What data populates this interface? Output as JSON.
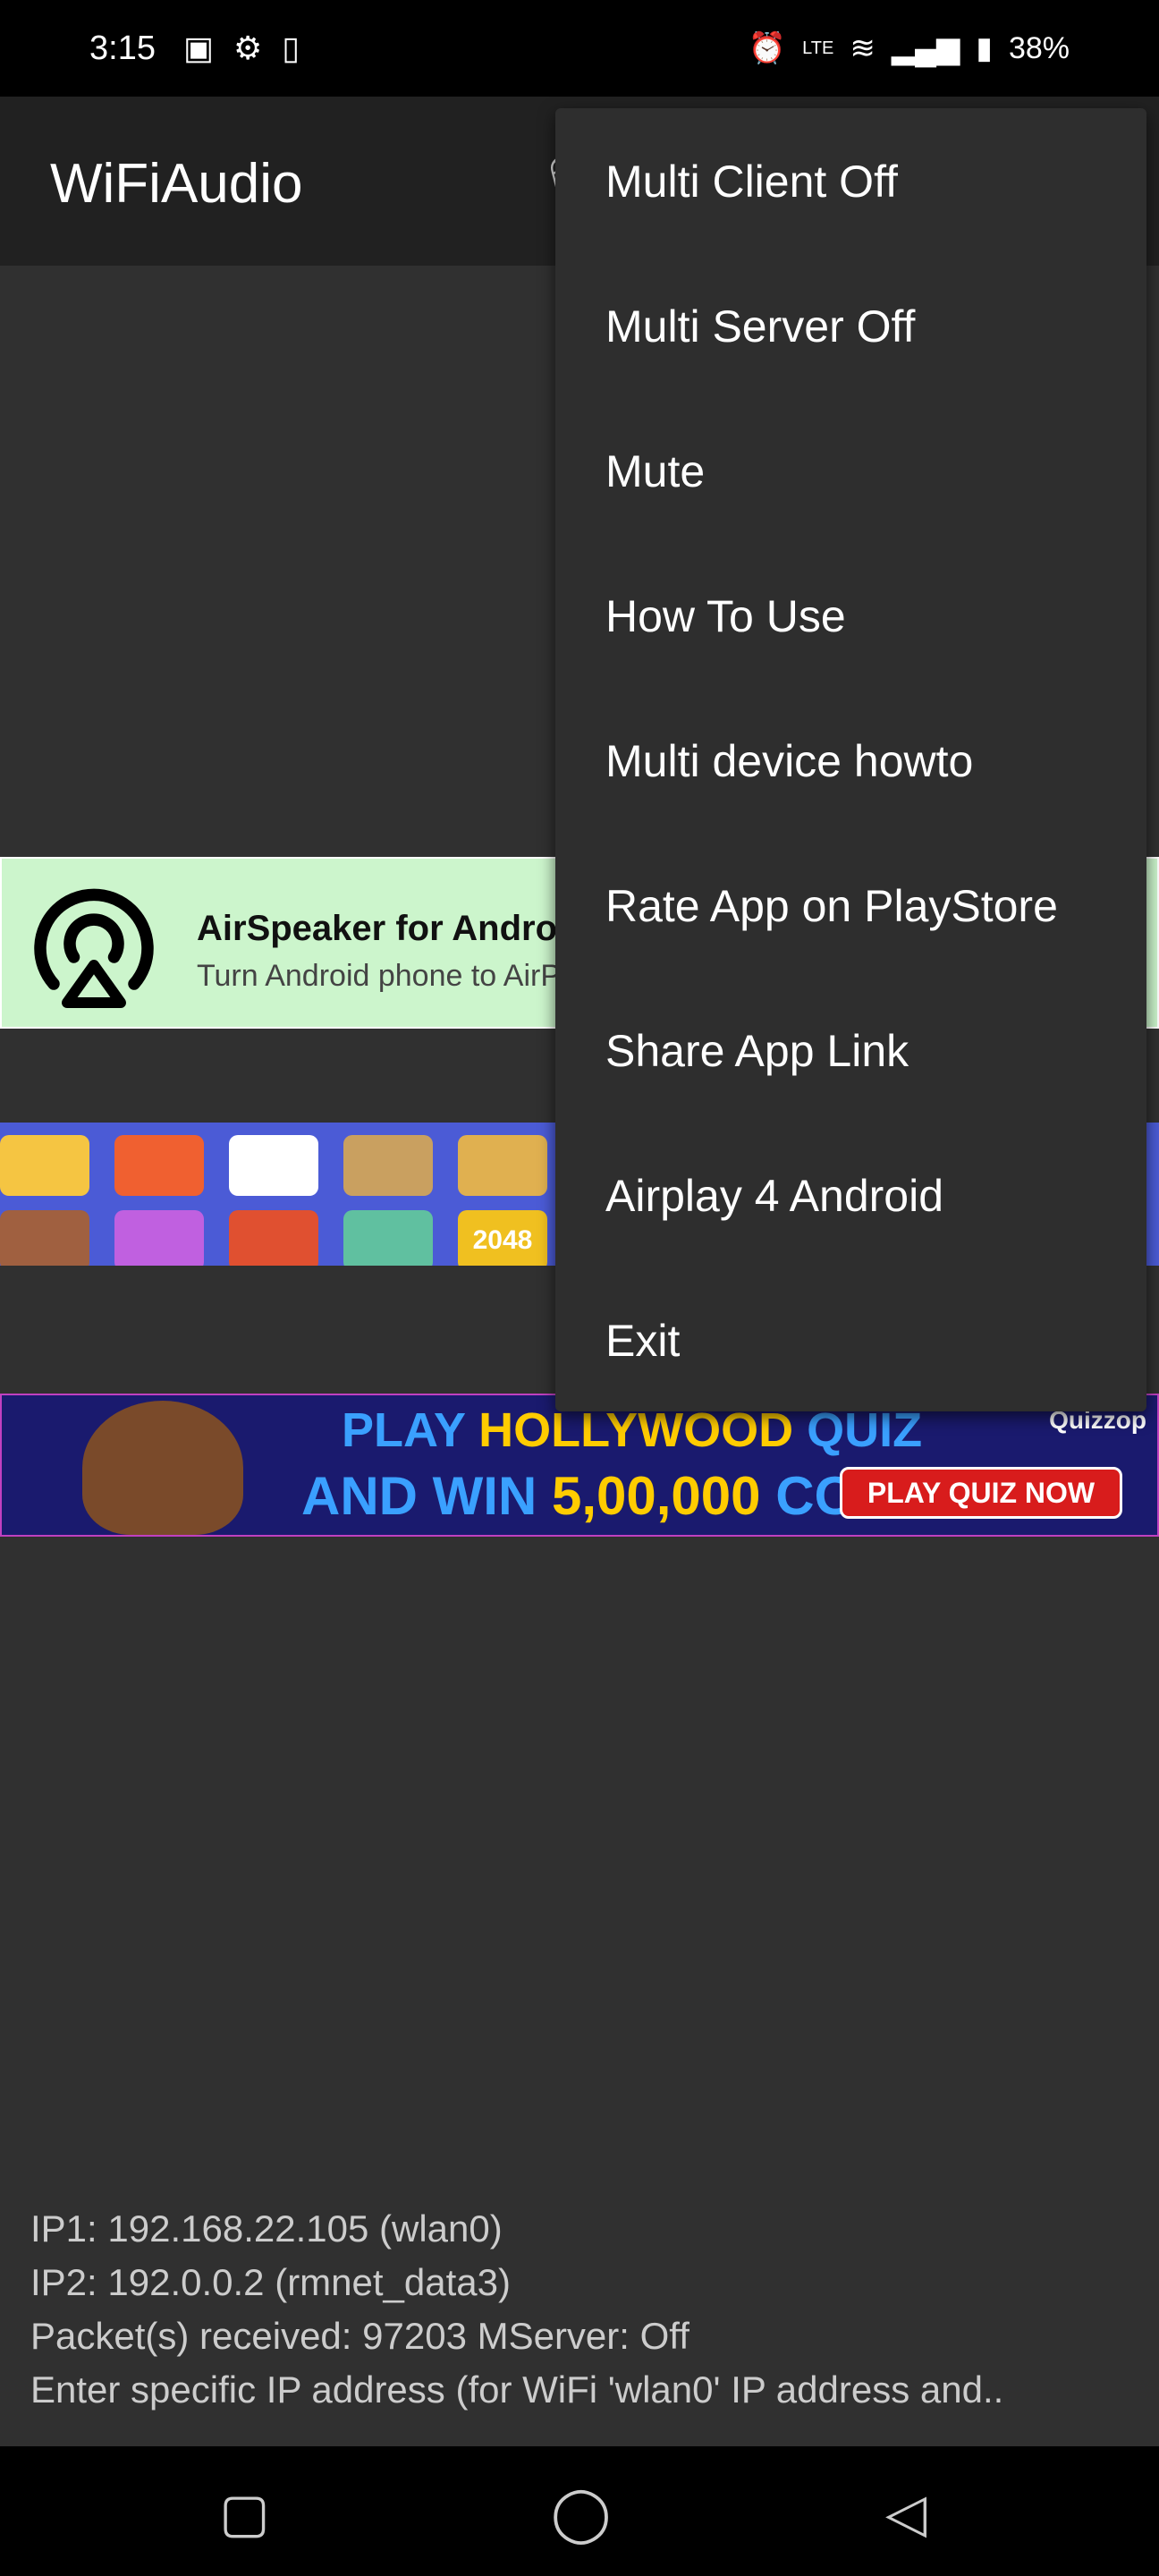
{
  "status_bar": {
    "time": "3:15",
    "battery": "38%",
    "left_icons": [
      "teams-icon",
      "gear-icon",
      "speaker-icon"
    ],
    "right_icons": [
      "alarm-icon",
      "volte-icon",
      "wifi-icon",
      "signal-icon",
      "battery-charging-icon"
    ]
  },
  "app_bar": {
    "title": "WiFiAudio"
  },
  "menu": {
    "items": [
      {
        "label": "Multi Client Off"
      },
      {
        "label": "Multi Server Off"
      },
      {
        "label": "Mute"
      },
      {
        "label": "How To Use"
      },
      {
        "label": "Multi device howto"
      },
      {
        "label": "Rate App on PlayStore"
      },
      {
        "label": "Share App Link"
      },
      {
        "label": "Airplay 4 Android"
      },
      {
        "label": "Exit"
      }
    ]
  },
  "ads": {
    "airspeaker": {
      "title": "AirSpeaker for Android",
      "subtitle": "Turn Android phone to AirPlay"
    },
    "games": {
      "tile_label": "2048"
    },
    "quiz": {
      "line1a": "PLAY ",
      "line1b": "HOLLYWOOD",
      "line1c": " QUIZ",
      "line2a": "AND WIN ",
      "line2b": "5,00,000",
      "line2c": " COINS",
      "cta": "PLAY QUIZ NOW",
      "brand": "Quizzop"
    }
  },
  "info": {
    "ip1": "IP1: 192.168.22.105 (wlan0)",
    "ip2": "IP2: 192.0.0.2 (rmnet_data3)",
    "packets": "Packet(s) received: 97203  MServer: Off",
    "hint": "Enter specific IP address (for WiFi 'wlan0' IP address and.."
  },
  "colors": {
    "background": "#303030",
    "app_bar": "#212121",
    "menu": "#2e2e2e"
  }
}
